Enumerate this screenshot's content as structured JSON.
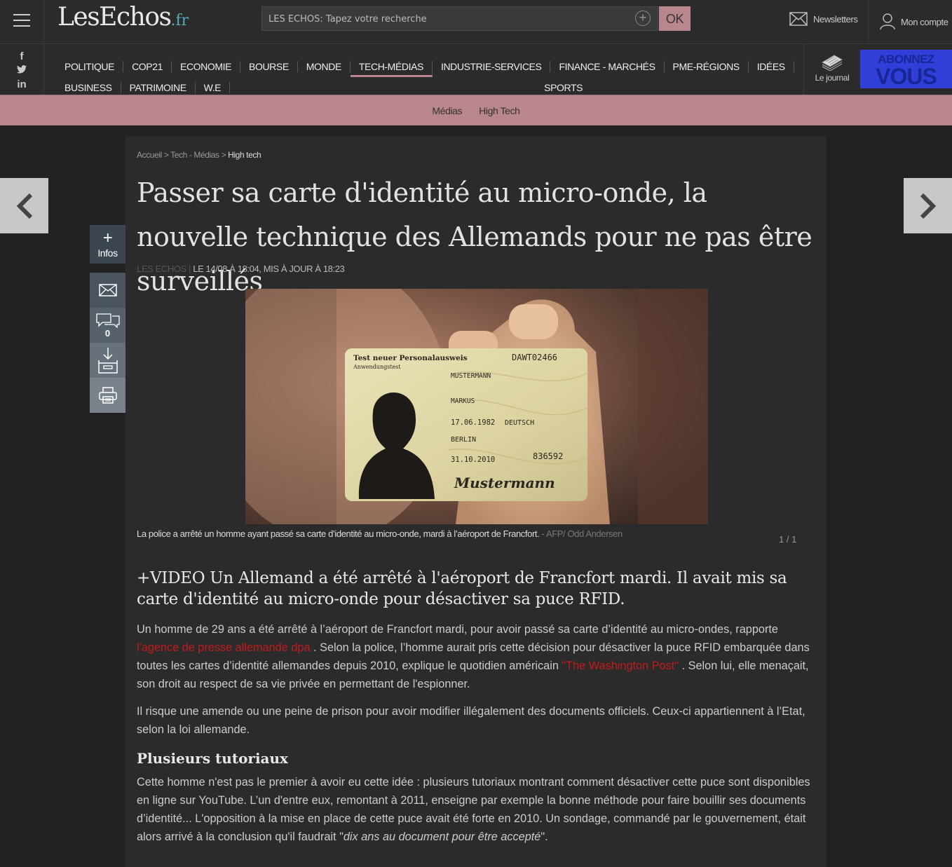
{
  "header": {
    "logo": "LesEchos",
    "logo_suffix": ".fr",
    "search_placeholder": "LES ECHOS: Tapez votre recherche",
    "ok_label": "OK",
    "newsletters_label": "Newsletters",
    "account_label": "Mon compte"
  },
  "nav": {
    "items": [
      "POLITIQUE",
      "COP21",
      "ECONOMIE",
      "BOURSE",
      "MONDE",
      "TECH-MÉDIAS",
      "INDUSTRIE-SERVICES",
      "FINANCE - MARCHÉS",
      "PME-RÉGIONS",
      "IDÉES",
      "BUSINESS",
      "PATRIMOINE",
      "W.E",
      "SPORTS"
    ],
    "active": "TECH-MÉDIAS",
    "journal_label": "Le journal",
    "abonnez_line1": "ABONNEZ",
    "abonnez_line2": "VOUS"
  },
  "subnav": {
    "items": [
      "Médias",
      "High Tech"
    ]
  },
  "breadcrumb": {
    "home": "Accueil",
    "section": "Tech - Médias",
    "current": "High tech"
  },
  "article": {
    "title": "Passer sa carte d'identité au micro-onde, la nouvelle technique des Allemands pour ne pas être surveillés",
    "source": "LES ECHOS",
    "date": "LE 14/08 À 18:04, MIS À JOUR À 18:23",
    "caption": "La police a arrêté un homme ayant passé sa carte d’identité au micro-onde, mardi à l’aéroport de Francfort.",
    "credit": "- AFP/ Odd Andersen",
    "counter": "1 / 1",
    "lead": "+VIDEO Un Allemand a été arrêté à l'aéroport de Francfort mardi. Il avait mis sa carte d'identité au micro-onde pour désactiver sa puce RFID.",
    "p1_a": "Un homme de 29 ans a été arrêté à l’aéroport de Francfort mardi, pour avoir passé sa carte d’identité au micro-ondes, rapporte ",
    "p1_link1": "l'agence de presse allemande dpa",
    "p1_b": " . Selon la police, l’homme aurait pris cette décision pour désactiver la puce RFID embarquée dans toutes les cartes d’identité allemandes depuis 2010, explique le quotidien américain ",
    "p1_link2": "\"The Washington Post\"",
    "p1_c": " . Selon lui, elle menaçait, son droit au respect de sa vie privée en permettant de l'espionner.",
    "p2": "Il risque une amende ou une peine de prison pour avoir modifier illégalement des documents officiels. Ceux-ci appartiennent à l’Etat, selon la loi allemande.",
    "subheading": "Plusieurs tutoriaux",
    "p3_a": "Cette homme n'est pas le premier à avoir eu cette idée : plusieurs tutoriaux montrant comment désactiver cette puce sont disponibles en ligne sur YouTube. L’un d'entre eux, remontant à 2011, enseigne par exemple la bonne méthode pour faire bouillir ses documents d’identité... L'opposition à la mise en place de cette puce avait été forte en 2010. Un sondage, commandé par le gouvernement, était alors arrivé à la conclusion qu'il faudrait \"",
    "p3_quote": "dix ans au document pour être accepté",
    "p3_b": "\"."
  },
  "id_card": {
    "title": "Test neuer Personalausweis",
    "subtitle": "Anwendungstest",
    "number": "DAWT02466",
    "surname": "MUSTERMANN",
    "given": "MARKUS",
    "birth": "17.06.1982",
    "nationality": "DEUTSCH",
    "place": "BERLIN",
    "expiry": "31.10.2010",
    "code": "836592",
    "signature": "Mustermann"
  },
  "tools": {
    "infos_label": "Infos",
    "comments_count": "0"
  }
}
